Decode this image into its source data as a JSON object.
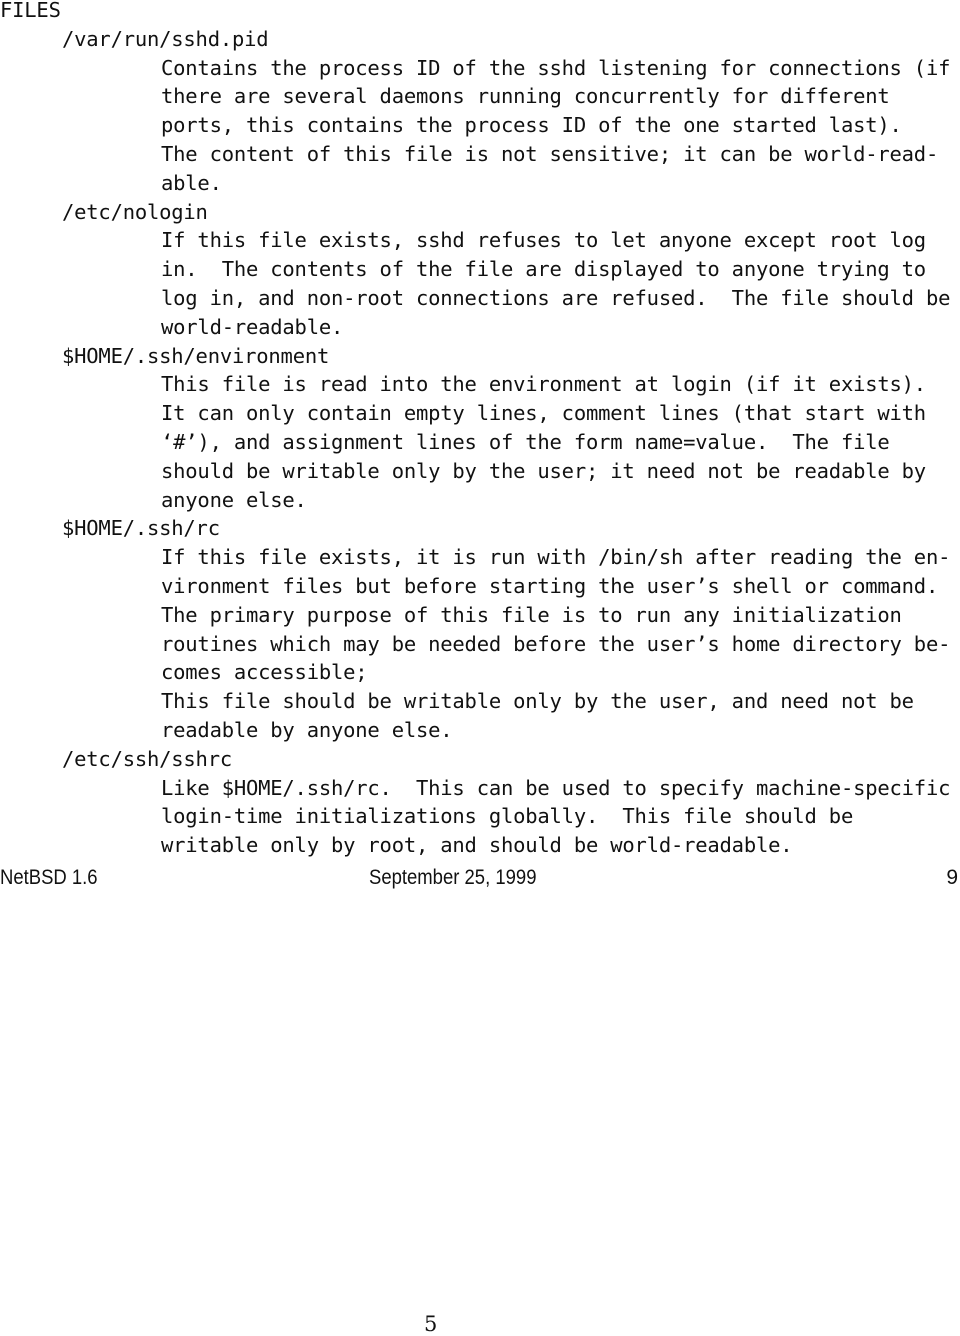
{
  "section_heading": "FILES",
  "entries": [
    {
      "path": "/var/run/sshd.pid",
      "lines": [
        "Contains the process ID of the sshd listening for connections (if",
        "there are several daemons running concurrently for different",
        "ports, this contains the process ID of the one started last).",
        "The content of this file is not sensitive; it can be world-read-",
        "able."
      ]
    },
    {
      "path": "/etc/nologin",
      "lines": [
        "If this file exists, sshd refuses to let anyone except root log",
        "in.  The contents of the file are displayed to anyone trying to",
        "log in, and non-root connections are refused.  The file should be",
        "world-readable."
      ]
    },
    {
      "path": "$HOME/.ssh/environment",
      "lines": [
        "This file is read into the environment at login (if it exists).",
        "It can only contain empty lines, comment lines (that start with",
        "‘#’), and assignment lines of the form name=value.  The file",
        "should be writable only by the user; it need not be readable by",
        "anyone else."
      ]
    },
    {
      "path": "$HOME/.ssh/rc",
      "lines": [
        "If this file exists, it is run with /bin/sh after reading the en-",
        "vironment files but before starting the user’s shell or command.",
        "The primary purpose of this file is to run any initialization",
        "routines which may be needed before the user’s home directory be-",
        "comes accessible;",
        "This file should be writable only by the user, and need not be",
        "readable by anyone else."
      ]
    },
    {
      "path": "/etc/ssh/sshrc",
      "lines": [
        "Like $HOME/.ssh/rc.  This can be used to specify machine-specific",
        "login-time initializations globally.  This file should be",
        "writable only by root, and should be world-readable."
      ]
    }
  ],
  "footer": {
    "os_version": "NetBSD 1.6",
    "date": "September 25, 1999",
    "man_page_number": "9"
  },
  "document_page_number": "5"
}
